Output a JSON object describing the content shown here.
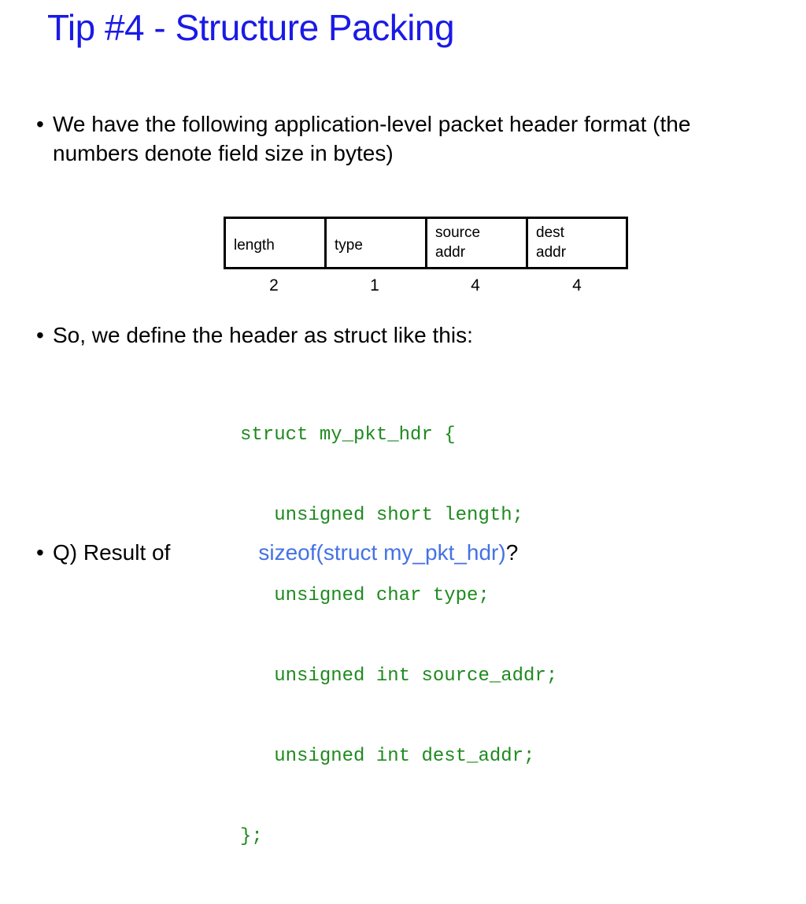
{
  "slide": {
    "title": "Tip #4 - Structure Packing",
    "title_color": "#1A1AE6",
    "background_color": "#FFFFFF"
  },
  "bullets": [
    {
      "marker": "•",
      "text": "We have the following application-level packet header format (the numbers denote field size in bytes)"
    },
    {
      "marker": "•",
      "text": "So, we define the header as struct like this:"
    },
    {
      "marker": "•",
      "lead_text": "Q) Result of",
      "accent_text": "sizeof(struct my_pkt_hdr)",
      "accent_color": "#4472E4",
      "trail_text": "?"
    }
  ],
  "packet_header": {
    "fields": [
      {
        "label_line1": "length",
        "label_line2": "",
        "size_bytes": "2"
      },
      {
        "label_line1": "type",
        "label_line2": "",
        "size_bytes": "1"
      },
      {
        "label_line1": "source",
        "label_line2": "addr",
        "size_bytes": "4"
      },
      {
        "label_line1": "dest",
        "label_line2": "addr",
        "size_bytes": "4"
      }
    ],
    "border_color": "#000000"
  },
  "code": {
    "color": "#1E8A1E",
    "lines": [
      "struct my_pkt_hdr {",
      "   unsigned short length;",
      "   unsigned char type;",
      "   unsigned int source_addr;",
      "   unsigned int dest_addr;",
      "};"
    ]
  }
}
